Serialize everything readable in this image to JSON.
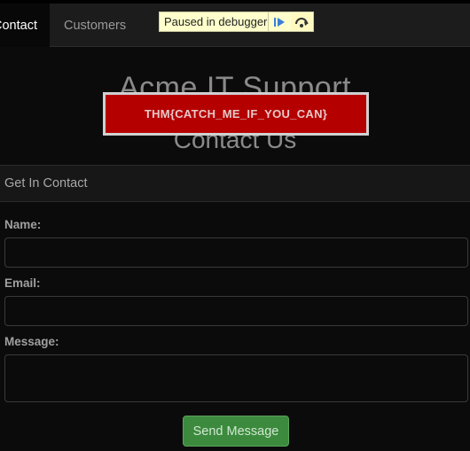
{
  "nav": {
    "items": [
      {
        "label": "Contact",
        "active": true
      },
      {
        "label": "Customers",
        "active": false
      }
    ]
  },
  "debugger": {
    "label": "Paused in debugger",
    "resume_icon": "resume-icon",
    "step_icon": "step-over-icon"
  },
  "hero": {
    "line1": "Acme IT Support",
    "line2": "Contact Us"
  },
  "flag": {
    "text": "THM{CATCH_ME_IF_YOU_CAN}"
  },
  "contact_form": {
    "heading": "Get In Contact",
    "name_label": "Name:",
    "name_value": "",
    "email_label": "Email:",
    "email_value": "",
    "message_label": "Message:",
    "message_value": "",
    "submit_label": "Send Message"
  },
  "colors": {
    "background": "#0b0b0b",
    "navbar": "#1c1c1c",
    "flag_bg": "#b50000",
    "button": "#3c8a3e",
    "debugger_bg": "#ffffcc"
  }
}
